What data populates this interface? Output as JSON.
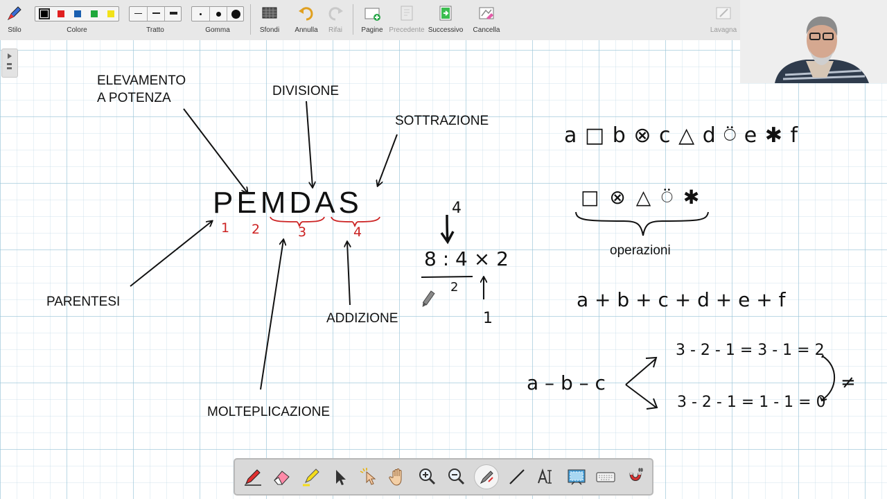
{
  "toolbar": {
    "stilo": "Stilo",
    "colore": "Colore",
    "tratto": "Tratto",
    "gomma": "Gomma",
    "sfondi": "Sfondi",
    "annulla": "Annulla",
    "rifai": "Rifai",
    "pagine": "Pagine",
    "precedente": "Precedente",
    "successivo": "Successivo",
    "cancella": "Cancella",
    "lavagna": "Lavagna",
    "colors": [
      "#000000",
      "#e02020",
      "#1a5fb0",
      "#1fa83c",
      "#f2e21a"
    ]
  },
  "board": {
    "pemdas": "PEMDAS",
    "elevamento_1": "ELEVAMENTO",
    "elevamento_2": "A POTENZA",
    "divisione": "DIVISIONE",
    "sottrazione": "SOTTRAZIONE",
    "parentesi": "PARENTESI",
    "moltiplicazione": "MOLTEPLICAZIONE",
    "addizione": "ADDIZIONE",
    "order_1": "1",
    "order_2": "2",
    "order_3": "3",
    "order_4": "4",
    "ex_top": "4",
    "ex_main": "8 : 4 × 2",
    "ex_below": "2",
    "ex_step": "1",
    "operazioni": "operazioni",
    "symbols_line": "a □ b ⊗ c △ d ⍥ e ✱ f",
    "symbols_only": "□ ⊗ △ ⍥ ✱",
    "sum_line": "a + b + c + d + e + f",
    "sub_expr": "a – b – c",
    "sub_result_1": "3 - 2 - 1 = 3 - 1 = 2",
    "sub_result_2": "3 - 2 - 1 = 1 - 1 = 0",
    "not_equal": "≠"
  },
  "accent": "#cc2222"
}
